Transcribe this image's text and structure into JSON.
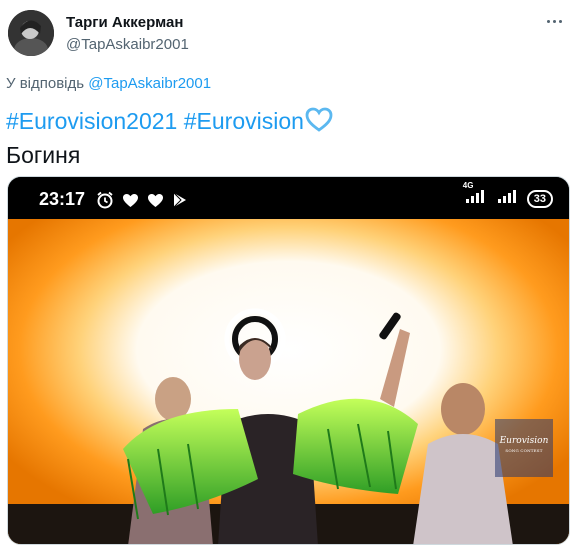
{
  "author": {
    "display_name": "Тарги Аккерман",
    "handle": "@TapAskaibr2001"
  },
  "reply": {
    "prefix": "У відповідь",
    "to_handle": "@TapAskaibr2001"
  },
  "tweet": {
    "hashtags": [
      "#Eurovision2021",
      "#Eurovision"
    ],
    "text": "Богиня"
  },
  "media": {
    "status_time": "23:17",
    "network_label": "4G",
    "battery_level": "33",
    "logo_title": "Eurovision",
    "logo_subtitle": "SONG CONTEST"
  },
  "colors": {
    "link": "#1d9bf0",
    "muted": "#536471",
    "heart": "#5bb8f0"
  },
  "icons": [
    "more-icon",
    "alarm-icon",
    "heart-status-icon",
    "play-store-icon",
    "signal-icon",
    "wifi-bars-icon",
    "battery-icon",
    "light-blue-heart-emoji"
  ]
}
